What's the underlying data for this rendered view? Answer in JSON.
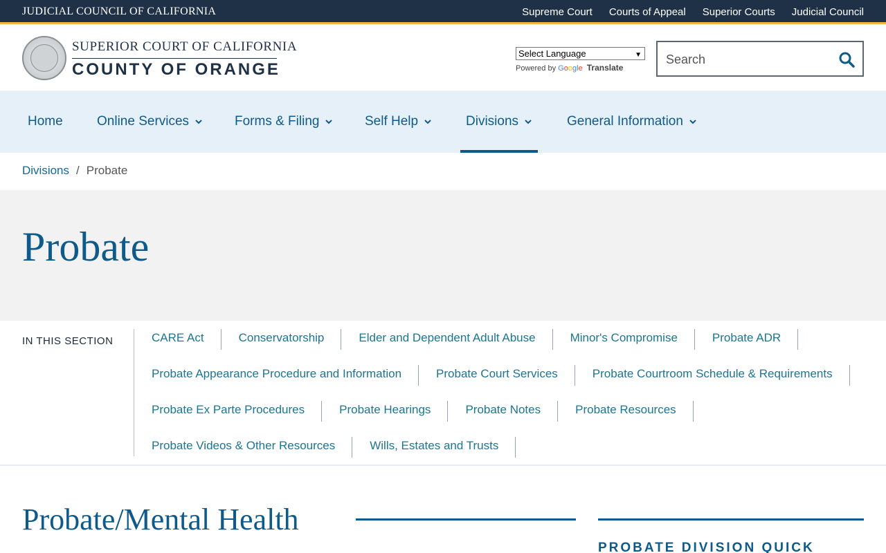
{
  "topbar": {
    "title": "JUDICIAL COUNCIL OF CALIFORNIA",
    "links": [
      "Supreme Court",
      "Courts of Appeal",
      "Superior Courts",
      "Judicial Council"
    ]
  },
  "header": {
    "court_line1": "SUPERIOR COURT OF CALIFORNIA",
    "court_line2": "COUNTY OF ORANGE",
    "language_select": "Select Language",
    "powered_by": "Powered by",
    "google": [
      "G",
      "o",
      "o",
      "g",
      "l",
      "e"
    ],
    "translate": "Translate",
    "search_placeholder": "Search"
  },
  "nav": {
    "items": [
      {
        "label": "Home"
      },
      {
        "label": "Online Services"
      },
      {
        "label": "Forms & Filing"
      },
      {
        "label": "Self Help"
      },
      {
        "label": "Divisions"
      },
      {
        "label": "General Information"
      }
    ],
    "active": "Divisions"
  },
  "breadcrumb": {
    "parent": "Divisions",
    "separator": "/",
    "current": "Probate"
  },
  "hero": {
    "title": "Probate"
  },
  "section": {
    "label": "IN THIS SECTION",
    "rows": [
      [
        "CARE Act",
        "Conservatorship",
        "Elder and Dependent Adult Abuse",
        "Minor's Compromise",
        "Probate ADR"
      ],
      [
        "Probate Appearance Procedure and Information",
        "Probate Court Services",
        "Probate Courtroom Schedule & Requirements"
      ],
      [
        "Probate Ex Parte Procedures",
        "Probate Hearings",
        "Probate Notes",
        "Probate Resources"
      ],
      [
        "Probate Videos & Other Resources",
        "Wills, Estates and Trusts"
      ]
    ]
  },
  "content": {
    "title": "Probate/Mental Health",
    "side_title": "PROBATE DIVISION QUICK"
  },
  "colors": {
    "topbar": "#1f3146",
    "accent": "#f2b83a",
    "link": "#0e5a8a",
    "nav_bg": "#e6f0f8",
    "hero_bg": "#f2f2f2"
  }
}
